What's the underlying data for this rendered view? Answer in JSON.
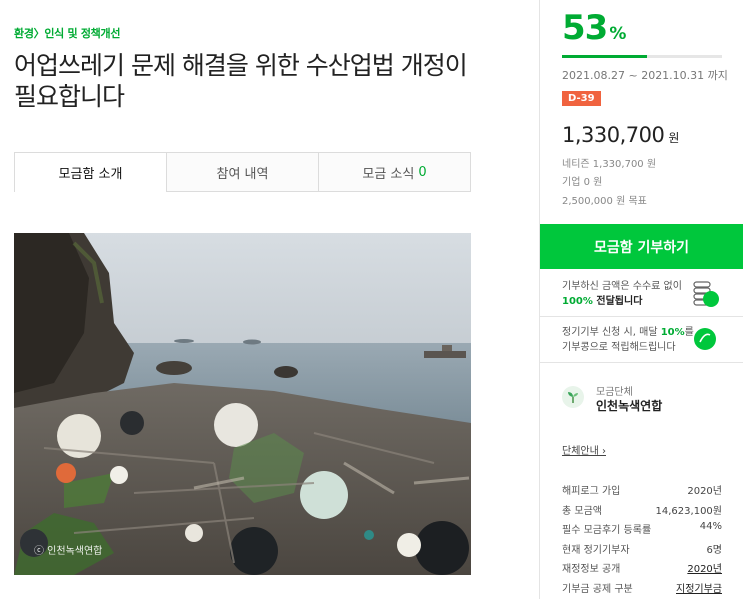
{
  "breadcrumb": {
    "category": "환경",
    "separator": "〉",
    "subcategory": "인식 및 정책개선"
  },
  "title": "어업쓰레기 문제 해결을 위한 수산업법 개정이 필요합니다",
  "tabs": [
    {
      "label": "모금함 소개",
      "active": true
    },
    {
      "label": "참여 내역"
    },
    {
      "label": "모금 소식",
      "count": "0"
    }
  ],
  "photo": {
    "credit": "ⓒ 인천녹색연합",
    "alt": "shore-debris-photo"
  },
  "progress": {
    "percent": "53",
    "percent_unit": "%",
    "fraction": 0.53
  },
  "period": "2021.08.27 ~ 2021.10.31 까지",
  "dday": "D-39",
  "amount": {
    "value": "1,330,700",
    "unit": "원"
  },
  "breakdown": {
    "netizen": "네티즌 1,330,700 원",
    "company": "기업 0 원",
    "goal": "2,500,000 원 목표"
  },
  "donate_button": "모금함 기부하기",
  "notices": {
    "fee": {
      "line1": "기부하신 금액은 수수료 없이",
      "highlight": "100%",
      "line2": " 전달됩니다"
    },
    "regular": {
      "line1": "정기기부 신청 시, 매달 ",
      "highlight": "10%",
      "line1_end": "를",
      "line2": "기부콩으로 적립해드립니다"
    }
  },
  "org": {
    "label": "모금단체",
    "name": "인천녹색연합",
    "link": "단체안내 ›"
  },
  "stats": [
    {
      "label": "해피로그 가입",
      "value": "2020년"
    },
    {
      "label": "총 모금액",
      "value": "14,623,100원"
    },
    {
      "label": "필수 모금후기 등록률",
      "value": "44%"
    },
    {
      "label": "현재 정기기부자",
      "value": "6명"
    },
    {
      "label": "재정정보 공개",
      "value": "2020년",
      "underline": true
    },
    {
      "label": "기부금 공제 구분",
      "value": "지정기부금",
      "underline": true
    }
  ],
  "colors": {
    "accent": "#00ab33",
    "button": "#00c73c",
    "dday": "#f0633f"
  }
}
